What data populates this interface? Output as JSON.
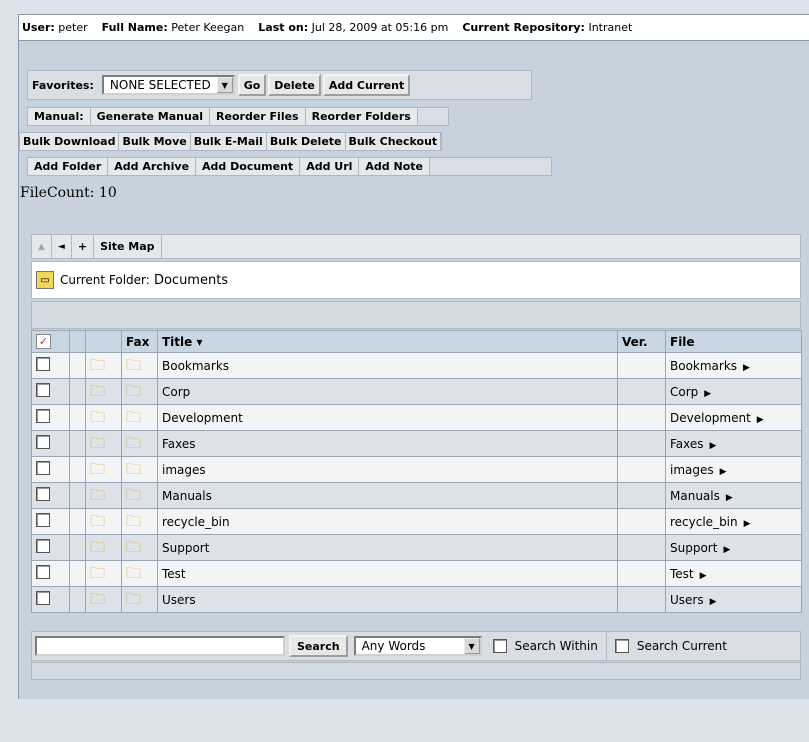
{
  "userbar": {
    "user_label": "User:",
    "user": "peter",
    "fullname_label": "Full Name:",
    "fullname": "Peter Keegan",
    "laston_label": "Last on:",
    "laston": "Jul 28, 2009 at 05:16 pm",
    "repo_label": "Current Repository:",
    "repo": "Intranet"
  },
  "favorites": {
    "label": "Favorites:",
    "selected": "NONE SELECTED",
    "go": "Go",
    "delete": "Delete",
    "add_current": "Add Current"
  },
  "manual": {
    "label": "Manual:",
    "items": [
      "Generate Manual",
      "Reorder Files",
      "Reorder Folders"
    ]
  },
  "bulk": {
    "items": [
      "Bulk Download",
      "Bulk Move",
      "Bulk E-Mail",
      "Bulk Delete",
      "Bulk Checkout"
    ]
  },
  "add": {
    "items": [
      "Add Folder",
      "Add Archive",
      "Add Document",
      "Add Url",
      "Add Note"
    ]
  },
  "filecount": "FileCount: 10",
  "nav": {
    "up": "▲",
    "back": "◄",
    "add": "+",
    "sitemap": "Site Map"
  },
  "current_folder": {
    "label": "Current Folder:",
    "name": "Documents"
  },
  "table": {
    "headers": {
      "fax": "Fax",
      "title": "Title ▾",
      "ver": "Ver.",
      "file": "File"
    },
    "rows": [
      {
        "title": "Bookmarks",
        "file": "Bookmarks"
      },
      {
        "title": "Corp",
        "file": "Corp"
      },
      {
        "title": "Development",
        "file": "Development"
      },
      {
        "title": "Faxes",
        "file": "Faxes"
      },
      {
        "title": "images",
        "file": "images"
      },
      {
        "title": "Manuals",
        "file": "Manuals"
      },
      {
        "title": "recycle_bin",
        "file": "recycle_bin"
      },
      {
        "title": "Support",
        "file": "Support"
      },
      {
        "title": "Test",
        "file": "Test"
      },
      {
        "title": "Users",
        "file": "Users"
      }
    ]
  },
  "search": {
    "button": "Search",
    "mode": "Any Words",
    "within": "Search Within",
    "current": "Search Current"
  }
}
